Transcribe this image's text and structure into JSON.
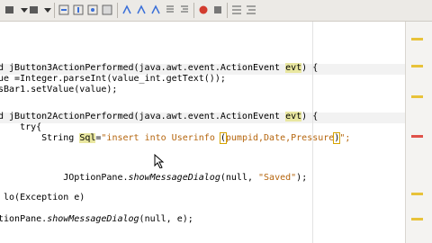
{
  "toolbar": {
    "buttons": [
      "nav-back-icon",
      "nav-forward-icon",
      "nav-dropdown-icon",
      "prev-occurrence-icon",
      "next-occurrence-icon",
      "find-selection-icon",
      "toggle-highlight-icon",
      "toggle-rectangular-icon",
      "shift-left-icon",
      "shift-right-icon",
      "start-macro-icon",
      "stop-macro-icon",
      "comment-icon",
      "uncomment-icon"
    ],
    "colors": {
      "accent": "#3a6fd8",
      "stop": "#d23c2f"
    }
  },
  "editor": {
    "lines": [
      {
        "segments": [
          {
            "t": "d jButton3ActionPerformed(java.awt.event.ActionEvent "
          },
          {
            "t": "evt",
            "c": "sel"
          },
          {
            "t": ") {"
          }
        ]
      },
      {
        "segments": [
          {
            "t": "ue =Integer.parseInt(value_int.getText());"
          }
        ]
      },
      {
        "segments": [
          {
            "t": "sBar1.setValue(value);"
          }
        ]
      },
      {
        "segments": [
          {
            "t": "d jButton2ActionPerformed(java.awt.event.ActionEvent "
          },
          {
            "t": "evt",
            "c": "sel"
          },
          {
            "t": ") {"
          }
        ]
      },
      {
        "segments": [
          {
            "t": "    try{"
          }
        ]
      },
      {
        "segments": [
          {
            "t": "        String "
          },
          {
            "t": "Sql",
            "c": "sel"
          },
          {
            "t": "="
          },
          {
            "t": "\"insert into Userinfo ",
            "c": "str"
          },
          {
            "t": "(",
            "c": "bracket"
          },
          {
            "t": "pumpid,Date,Pressure",
            "c": "str"
          },
          {
            "t": ")",
            "c": "bracket"
          },
          {
            "t": "\";",
            "c": "str"
          }
        ]
      },
      {
        "segments": [
          {
            "t": "            JOptionPane."
          },
          {
            "t": "showMessageDialog",
            "c": "mth"
          },
          {
            "t": "(null, "
          },
          {
            "t": "\"Saved\"",
            "c": "str"
          },
          {
            "t": ");"
          }
        ]
      },
      {
        "segments": [
          {
            "t": " lo(Exception e)"
          }
        ]
      },
      {
        "segments": [
          {
            "t": "tionPane."
          },
          {
            "t": "showMessageDialog",
            "c": "mth"
          },
          {
            "t": "(null, e);"
          }
        ]
      }
    ]
  },
  "colors": {
    "background": "#ffffff",
    "string": "#b5650d",
    "marker_warning": "#e8c23a",
    "marker_error": "#e0524a"
  }
}
